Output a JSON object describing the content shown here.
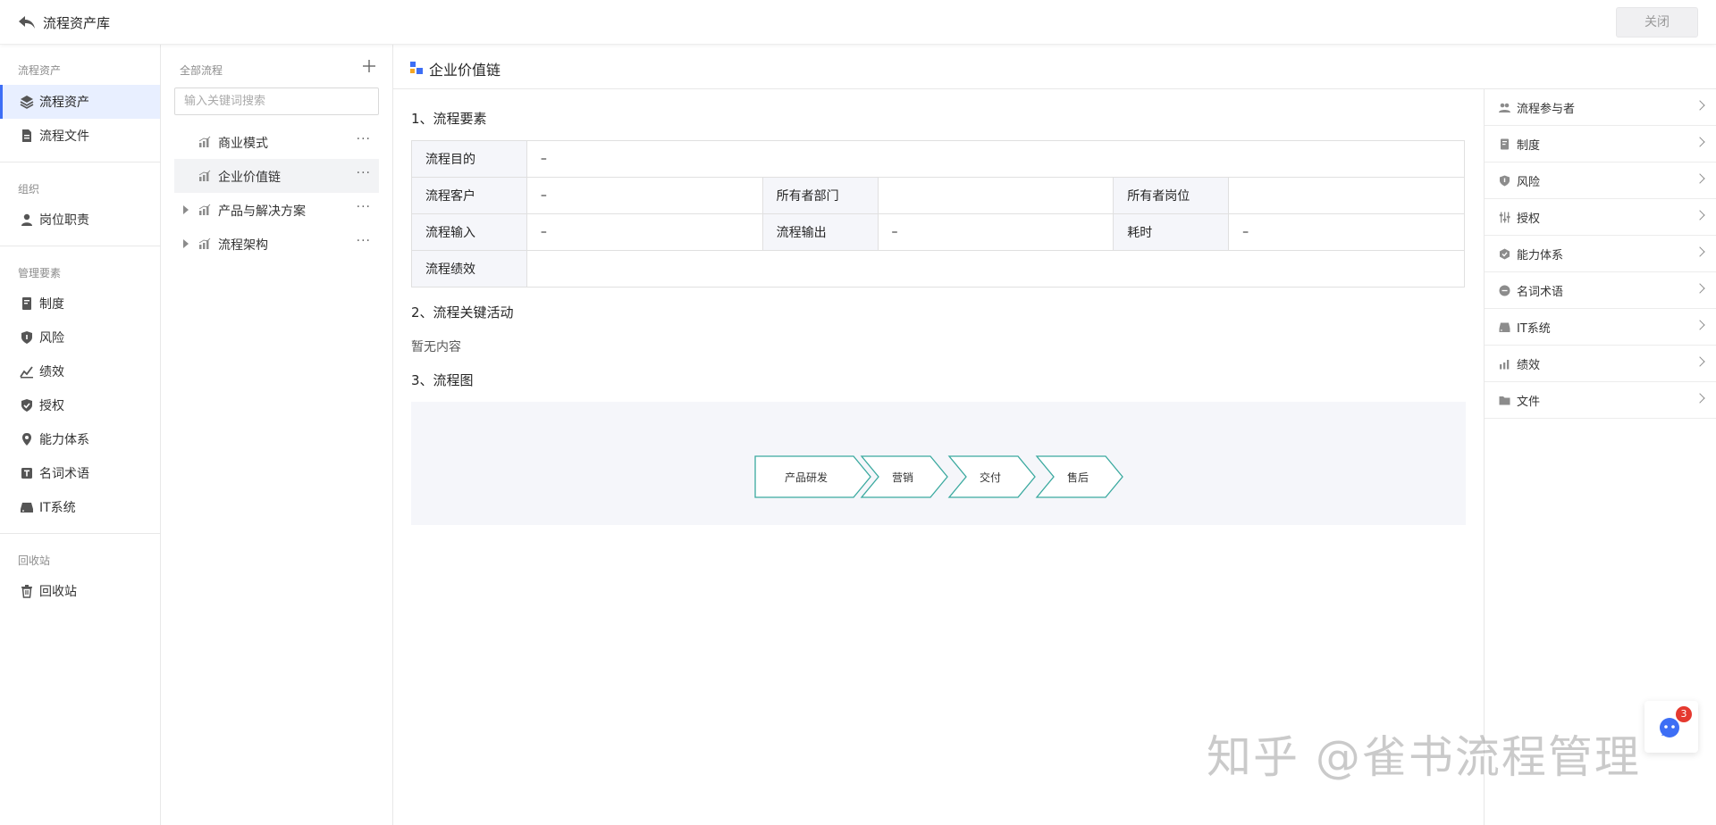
{
  "header": {
    "title": "流程资产库",
    "close_label": "关闭"
  },
  "leftnav": {
    "groups": [
      {
        "title": "流程资产",
        "items": [
          {
            "label": "流程资产",
            "icon": "layers-icon"
          },
          {
            "label": "流程文件",
            "icon": "file-icon"
          }
        ]
      },
      {
        "title": "组织",
        "items": [
          {
            "label": "岗位职责",
            "icon": "user-icon"
          }
        ]
      },
      {
        "title": "管理要素",
        "items": [
          {
            "label": "制度",
            "icon": "document-icon"
          },
          {
            "label": "风险",
            "icon": "shield-icon"
          },
          {
            "label": "绩效",
            "icon": "chart-icon"
          },
          {
            "label": "授权",
            "icon": "check-shield-icon"
          },
          {
            "label": "能力体系",
            "icon": "map-pin-icon"
          },
          {
            "label": "名词术语",
            "icon": "text-icon"
          },
          {
            "label": "IT系统",
            "icon": "server-icon"
          }
        ]
      },
      {
        "title": "回收站",
        "items": [
          {
            "label": "回收站",
            "icon": "trash-icon"
          }
        ]
      }
    ],
    "active": "流程资产"
  },
  "tree": {
    "title": "全部流程",
    "search_placeholder": "输入关键词搜索",
    "items": [
      {
        "label": "商业模式",
        "expandable": false
      },
      {
        "label": "企业价值链",
        "expandable": false,
        "selected": true
      },
      {
        "label": "产品与解决方案",
        "expandable": true
      },
      {
        "label": "流程架构",
        "expandable": true
      }
    ]
  },
  "main": {
    "title": "企业价值链",
    "section1": "1、流程要素",
    "props": {
      "purpose_k": "流程目的",
      "purpose_v": "–",
      "customer_k": "流程客户",
      "customer_v": "–",
      "owner_dept_k": "所有者部门",
      "owner_dept_v": "",
      "owner_post_k": "所有者岗位",
      "owner_post_v": "",
      "input_k": "流程输入",
      "input_v": "–",
      "output_k": "流程输出",
      "output_v": "–",
      "duration_k": "耗时",
      "duration_v": "–",
      "perf_k": "流程绩效",
      "perf_v": ""
    },
    "section2": "2、流程关键活动",
    "empty_text": "暂无内容",
    "section3": "3、流程图",
    "diagram_steps": [
      "产品研发",
      "营销",
      "交付",
      "售后"
    ],
    "diagram_color": "#3aa99f"
  },
  "rightpanel": {
    "items": [
      {
        "label": "流程参与者",
        "icon": "people-icon"
      },
      {
        "label": "制度",
        "icon": "document-icon"
      },
      {
        "label": "风险",
        "icon": "shield-icon"
      },
      {
        "label": "授权",
        "icon": "sliders-icon"
      },
      {
        "label": "能力体系",
        "icon": "hexagon-icon"
      },
      {
        "label": "名词术语",
        "icon": "chat-icon"
      },
      {
        "label": "IT系统",
        "icon": "server-icon"
      },
      {
        "label": "绩效",
        "icon": "chart-icon"
      },
      {
        "label": "文件",
        "icon": "folder-icon"
      }
    ]
  },
  "float": {
    "badge": "3"
  },
  "watermark": "知乎 @雀书流程管理",
  "colors": {
    "accent": "#3d6ef5",
    "active_bg": "#e8efff",
    "badge": "#e5392f"
  }
}
